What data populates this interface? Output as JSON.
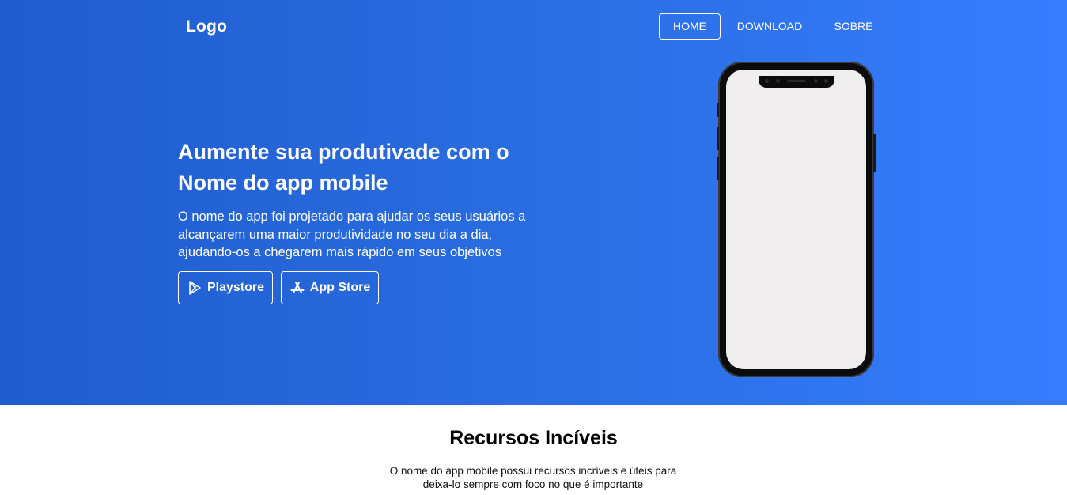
{
  "header": {
    "logo": "Logo",
    "nav": [
      {
        "label": "HOME",
        "active": true
      },
      {
        "label": "DOWNLOAD",
        "active": false
      },
      {
        "label": "SOBRE",
        "active": false
      }
    ]
  },
  "hero": {
    "headline": "Aumente sua produtivade com o Nome do app mobile",
    "description": "O nome do app foi projetado para ajudar os seus usuários a alcançarem uma maior produtividade no seu dia a dia, ajudando-os a chegarem mais rápido em seus objetivos",
    "buttons": {
      "playstore": {
        "label": "Playstore",
        "icon": "google-play-icon"
      },
      "appstore": {
        "label": "App Store",
        "icon": "app-store-icon"
      }
    },
    "image": {
      "icon": "smartphone-mockup"
    }
  },
  "features": {
    "title": "Recursos Incíveis",
    "description": "O nome do app mobile possui recursos incríveis e úteis para deixa-lo sempre com foco no que é importante"
  },
  "colors": {
    "hero_gradient_start": "#1f5cce",
    "hero_gradient_end": "#367cff",
    "text_on_hero": "#ffffff",
    "page_background": "#ffffff"
  }
}
